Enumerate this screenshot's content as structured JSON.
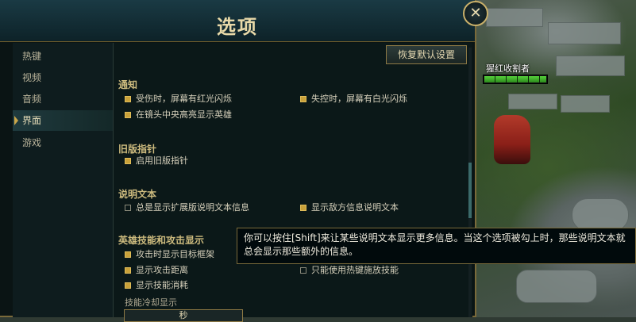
{
  "window": {
    "title": "选项",
    "close_glyph": "✕",
    "reset_button": "恢复默认设置"
  },
  "sidebar": {
    "items": [
      {
        "label": "热键",
        "active": false
      },
      {
        "label": "视频",
        "active": false
      },
      {
        "label": "音频",
        "active": false
      },
      {
        "label": "界面",
        "active": true
      },
      {
        "label": "游戏",
        "active": false
      }
    ]
  },
  "sections": {
    "notify": {
      "title": "通知",
      "options": [
        {
          "label": "受伤时，屏幕有红光闪烁",
          "checked": true
        },
        {
          "label": "失控时，屏幕有白光闪烁",
          "checked": true
        },
        {
          "label": "在镜头中央高亮显示英雄",
          "checked": true
        }
      ]
    },
    "legacy": {
      "title": "旧版指针",
      "options": [
        {
          "label": "启用旧版指针",
          "checked": true
        }
      ]
    },
    "tooltip": {
      "title": "说明文本",
      "options": [
        {
          "label": "总是显示扩展版说明文本信息",
          "checked": false
        },
        {
          "label": "显示敌方信息说明文本",
          "checked": true
        }
      ]
    },
    "abilities": {
      "title": "英雄技能和攻击显示",
      "options": [
        {
          "label": "攻击时显示目标框架",
          "checked": true
        },
        {
          "label": "显示攻击距离",
          "checked": true
        },
        {
          "label": "只能使用热键施放技能",
          "checked": false
        },
        {
          "label": "显示技能消耗",
          "checked": true
        }
      ],
      "cooldown_label": "技能冷却显示",
      "cooldown_value": "秒"
    }
  },
  "tooltip_popup": "你可以按住[Shift]来让某些说明文本显示更多信息。当这个选项被勾上时，那些说明文本就总会显示那些额外的信息。",
  "game": {
    "champion_name": "猩红收割者",
    "health_fraction": 1.0
  },
  "colors": {
    "accent_gold": "#c9a13a",
    "section_title": "#cdbb7e",
    "frame_border": "#7a6a3a"
  }
}
